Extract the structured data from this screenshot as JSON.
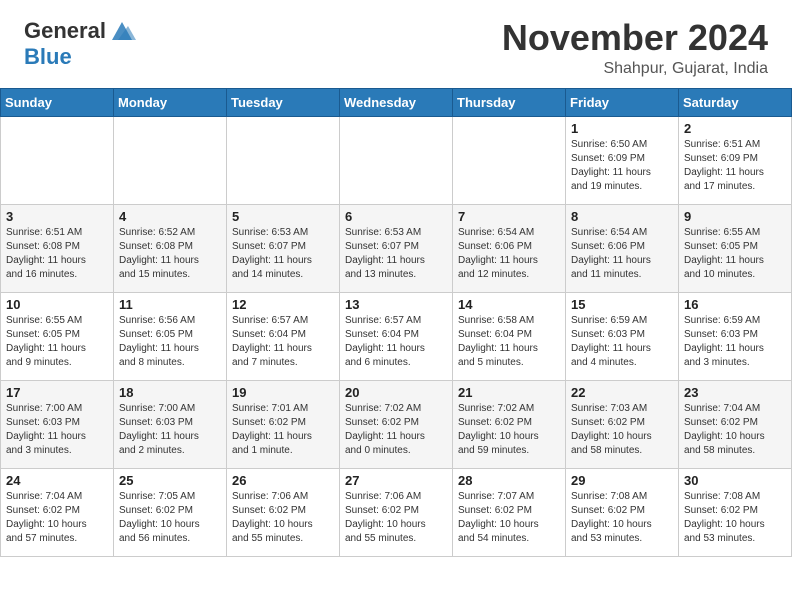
{
  "header": {
    "logo_general": "General",
    "logo_blue": "Blue",
    "month_title": "November 2024",
    "location": "Shahpur, Gujarat, India"
  },
  "weekdays": [
    "Sunday",
    "Monday",
    "Tuesday",
    "Wednesday",
    "Thursday",
    "Friday",
    "Saturday"
  ],
  "weeks": [
    [
      {
        "day": "",
        "info": ""
      },
      {
        "day": "",
        "info": ""
      },
      {
        "day": "",
        "info": ""
      },
      {
        "day": "",
        "info": ""
      },
      {
        "day": "",
        "info": ""
      },
      {
        "day": "1",
        "info": "Sunrise: 6:50 AM\nSunset: 6:09 PM\nDaylight: 11 hours\nand 19 minutes."
      },
      {
        "day": "2",
        "info": "Sunrise: 6:51 AM\nSunset: 6:09 PM\nDaylight: 11 hours\nand 17 minutes."
      }
    ],
    [
      {
        "day": "3",
        "info": "Sunrise: 6:51 AM\nSunset: 6:08 PM\nDaylight: 11 hours\nand 16 minutes."
      },
      {
        "day": "4",
        "info": "Sunrise: 6:52 AM\nSunset: 6:08 PM\nDaylight: 11 hours\nand 15 minutes."
      },
      {
        "day": "5",
        "info": "Sunrise: 6:53 AM\nSunset: 6:07 PM\nDaylight: 11 hours\nand 14 minutes."
      },
      {
        "day": "6",
        "info": "Sunrise: 6:53 AM\nSunset: 6:07 PM\nDaylight: 11 hours\nand 13 minutes."
      },
      {
        "day": "7",
        "info": "Sunrise: 6:54 AM\nSunset: 6:06 PM\nDaylight: 11 hours\nand 12 minutes."
      },
      {
        "day": "8",
        "info": "Sunrise: 6:54 AM\nSunset: 6:06 PM\nDaylight: 11 hours\nand 11 minutes."
      },
      {
        "day": "9",
        "info": "Sunrise: 6:55 AM\nSunset: 6:05 PM\nDaylight: 11 hours\nand 10 minutes."
      }
    ],
    [
      {
        "day": "10",
        "info": "Sunrise: 6:55 AM\nSunset: 6:05 PM\nDaylight: 11 hours\nand 9 minutes."
      },
      {
        "day": "11",
        "info": "Sunrise: 6:56 AM\nSunset: 6:05 PM\nDaylight: 11 hours\nand 8 minutes."
      },
      {
        "day": "12",
        "info": "Sunrise: 6:57 AM\nSunset: 6:04 PM\nDaylight: 11 hours\nand 7 minutes."
      },
      {
        "day": "13",
        "info": "Sunrise: 6:57 AM\nSunset: 6:04 PM\nDaylight: 11 hours\nand 6 minutes."
      },
      {
        "day": "14",
        "info": "Sunrise: 6:58 AM\nSunset: 6:04 PM\nDaylight: 11 hours\nand 5 minutes."
      },
      {
        "day": "15",
        "info": "Sunrise: 6:59 AM\nSunset: 6:03 PM\nDaylight: 11 hours\nand 4 minutes."
      },
      {
        "day": "16",
        "info": "Sunrise: 6:59 AM\nSunset: 6:03 PM\nDaylight: 11 hours\nand 3 minutes."
      }
    ],
    [
      {
        "day": "17",
        "info": "Sunrise: 7:00 AM\nSunset: 6:03 PM\nDaylight: 11 hours\nand 3 minutes."
      },
      {
        "day": "18",
        "info": "Sunrise: 7:00 AM\nSunset: 6:03 PM\nDaylight: 11 hours\nand 2 minutes."
      },
      {
        "day": "19",
        "info": "Sunrise: 7:01 AM\nSunset: 6:02 PM\nDaylight: 11 hours\nand 1 minute."
      },
      {
        "day": "20",
        "info": "Sunrise: 7:02 AM\nSunset: 6:02 PM\nDaylight: 11 hours\nand 0 minutes."
      },
      {
        "day": "21",
        "info": "Sunrise: 7:02 AM\nSunset: 6:02 PM\nDaylight: 10 hours\nand 59 minutes."
      },
      {
        "day": "22",
        "info": "Sunrise: 7:03 AM\nSunset: 6:02 PM\nDaylight: 10 hours\nand 58 minutes."
      },
      {
        "day": "23",
        "info": "Sunrise: 7:04 AM\nSunset: 6:02 PM\nDaylight: 10 hours\nand 58 minutes."
      }
    ],
    [
      {
        "day": "24",
        "info": "Sunrise: 7:04 AM\nSunset: 6:02 PM\nDaylight: 10 hours\nand 57 minutes."
      },
      {
        "day": "25",
        "info": "Sunrise: 7:05 AM\nSunset: 6:02 PM\nDaylight: 10 hours\nand 56 minutes."
      },
      {
        "day": "26",
        "info": "Sunrise: 7:06 AM\nSunset: 6:02 PM\nDaylight: 10 hours\nand 55 minutes."
      },
      {
        "day": "27",
        "info": "Sunrise: 7:06 AM\nSunset: 6:02 PM\nDaylight: 10 hours\nand 55 minutes."
      },
      {
        "day": "28",
        "info": "Sunrise: 7:07 AM\nSunset: 6:02 PM\nDaylight: 10 hours\nand 54 minutes."
      },
      {
        "day": "29",
        "info": "Sunrise: 7:08 AM\nSunset: 6:02 PM\nDaylight: 10 hours\nand 53 minutes."
      },
      {
        "day": "30",
        "info": "Sunrise: 7:08 AM\nSunset: 6:02 PM\nDaylight: 10 hours\nand 53 minutes."
      }
    ]
  ]
}
